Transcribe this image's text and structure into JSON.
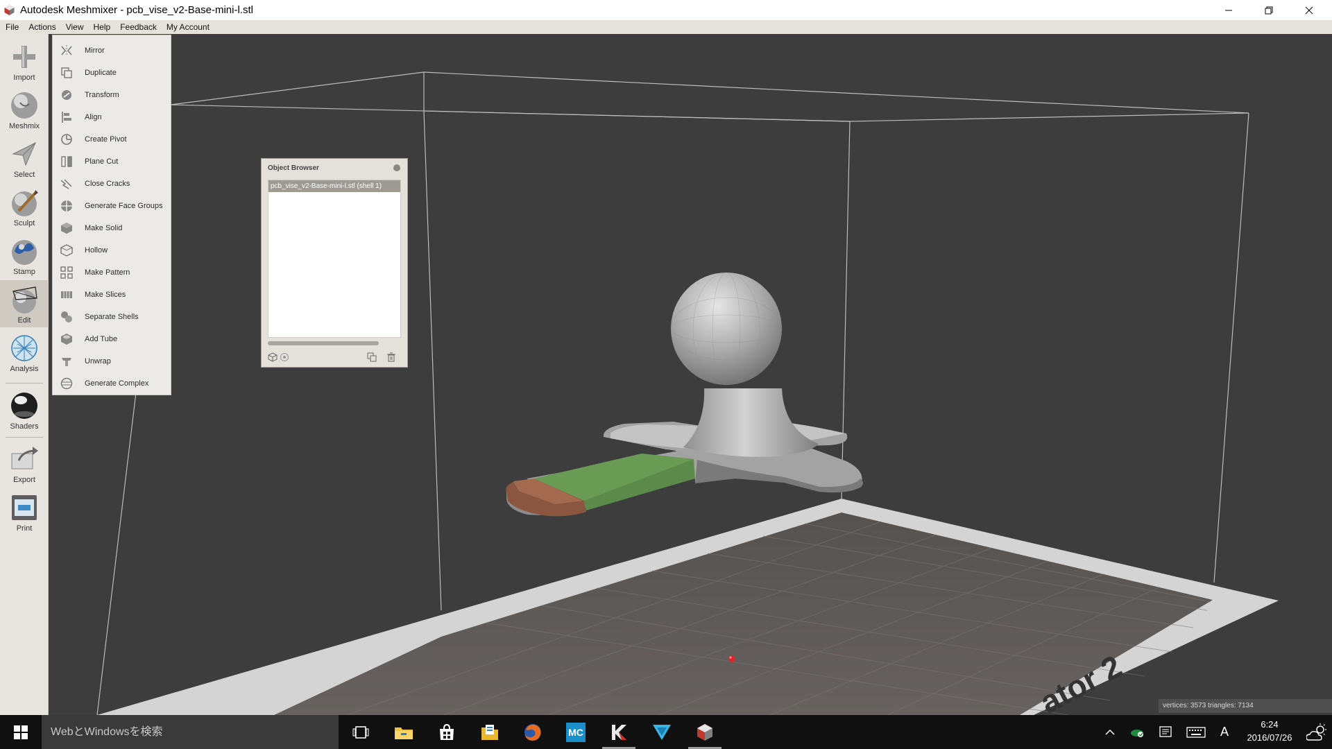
{
  "window": {
    "title": "Autodesk Meshmixer - pcb_vise_v2-Base-mini-l.stl"
  },
  "menubar": {
    "items": [
      {
        "label": "File"
      },
      {
        "label": "Actions"
      },
      {
        "label": "View"
      },
      {
        "label": "Help"
      },
      {
        "label": "Feedback"
      },
      {
        "label": "My Account"
      }
    ]
  },
  "toolbar": {
    "tools": [
      {
        "label": "Import",
        "icon": "import-icon"
      },
      {
        "label": "Meshmix",
        "icon": "meshmix-icon"
      },
      {
        "label": "Select",
        "icon": "select-icon"
      },
      {
        "label": "Sculpt",
        "icon": "sculpt-icon"
      },
      {
        "label": "Stamp",
        "icon": "stamp-icon"
      },
      {
        "label": "Edit",
        "icon": "edit-icon",
        "active": true
      },
      {
        "label": "Analysis",
        "icon": "analysis-icon"
      },
      {
        "label": "Shaders",
        "icon": "shaders-icon"
      },
      {
        "label": "Export",
        "icon": "export-icon"
      },
      {
        "label": "Print",
        "icon": "print-icon"
      }
    ]
  },
  "edit_menu": {
    "items": [
      {
        "label": "Mirror",
        "icon": "mirror-icon"
      },
      {
        "label": "Duplicate",
        "icon": "duplicate-icon"
      },
      {
        "label": "Transform",
        "icon": "transform-icon"
      },
      {
        "label": "Align",
        "icon": "align-icon"
      },
      {
        "label": "Create Pivot",
        "icon": "create-pivot-icon"
      },
      {
        "label": "Plane Cut",
        "icon": "plane-cut-icon"
      },
      {
        "label": "Close Cracks",
        "icon": "close-cracks-icon"
      },
      {
        "label": "Generate Face Groups",
        "icon": "face-groups-icon"
      },
      {
        "label": "Make Solid",
        "icon": "make-solid-icon"
      },
      {
        "label": "Hollow",
        "icon": "hollow-icon"
      },
      {
        "label": "Make Pattern",
        "icon": "make-pattern-icon"
      },
      {
        "label": "Make Slices",
        "icon": "make-slices-icon"
      },
      {
        "label": "Separate Shells",
        "icon": "separate-shells-icon"
      },
      {
        "label": "Add Tube",
        "icon": "add-tube-icon"
      },
      {
        "label": "Unwrap",
        "icon": "unwrap-icon"
      },
      {
        "label": "Generate Complex",
        "icon": "generate-complex-icon"
      }
    ]
  },
  "object_browser": {
    "title": "Object Browser",
    "objects": [
      {
        "name": "pcb_vise_v2-Base-mini-l.stl (shell 1)",
        "selected": true
      }
    ]
  },
  "viewport": {
    "build_plate_label": "ator 2",
    "stats": "vertices: 3573 triangles: 7134",
    "colors": {
      "background": "#3d3d3d",
      "model": "#b5b5b5",
      "face_group_green": "#5c8a4a",
      "face_group_brown": "#8a5640",
      "pivot": "#d62a2a"
    }
  },
  "taskbar": {
    "search_placeholder": "WebとWindowsを検索",
    "apps": [
      {
        "name": "task-view-icon"
      },
      {
        "name": "file-explorer-icon"
      },
      {
        "name": "store-icon"
      },
      {
        "name": "folder-app-icon"
      },
      {
        "name": "firefox-icon"
      },
      {
        "name": "mc-icon",
        "label": "MC"
      },
      {
        "name": "kaspersky-icon"
      },
      {
        "name": "v-app-icon"
      },
      {
        "name": "meshmixer-icon"
      }
    ],
    "ime_indicator": "A",
    "clock_time": "6:24",
    "clock_date": "2016/07/26"
  }
}
